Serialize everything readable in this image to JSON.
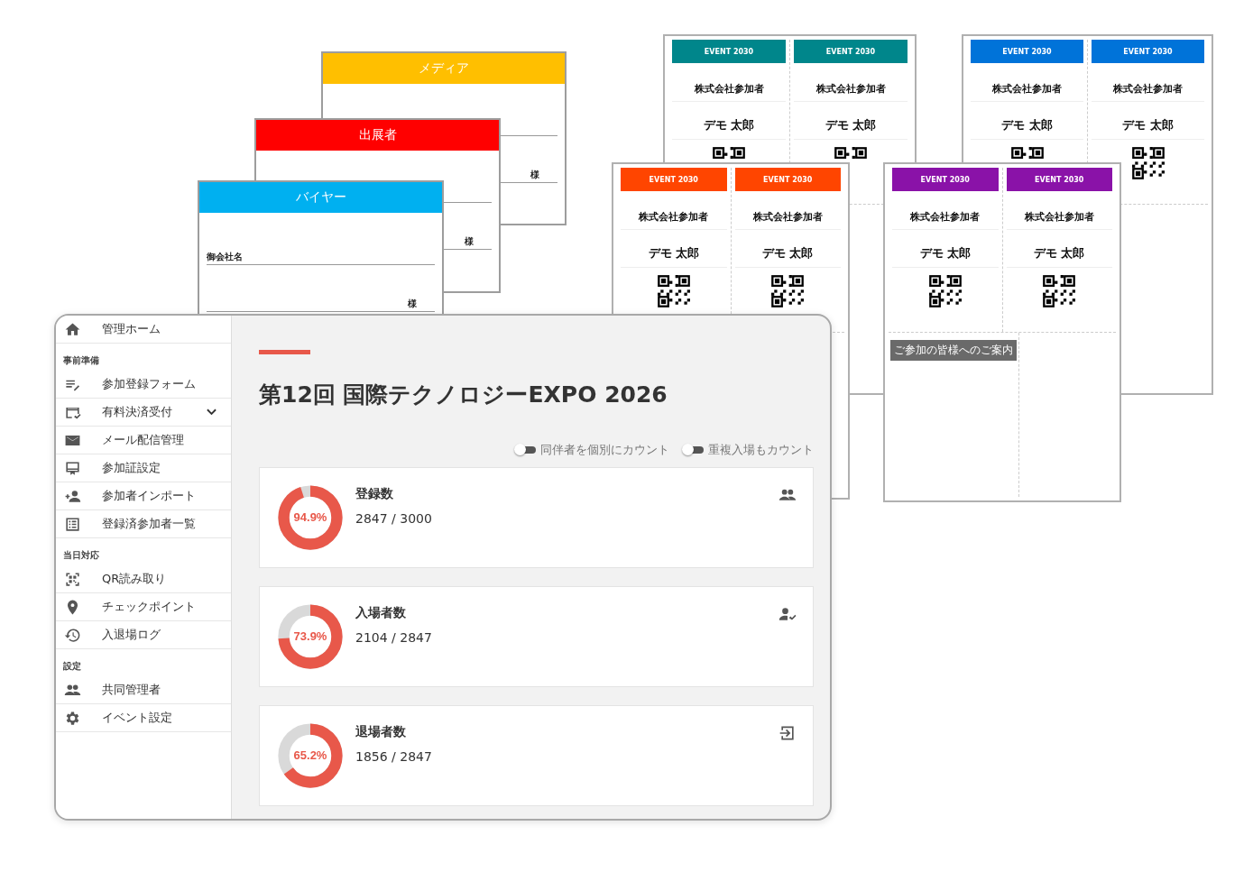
{
  "name_cards": [
    {
      "title": "メディア",
      "color": "#ffbf00",
      "honorific": "様"
    },
    {
      "title": "出展者",
      "color": "#ff0000",
      "honorific": "様"
    },
    {
      "title": "バイヤー",
      "color": "#00b0f0",
      "company_label": "御会社名",
      "honorific": "様"
    }
  ],
  "badge_sheets": [
    {
      "color": "#00868b",
      "badges": [
        {
          "header": "EVENT 2030",
          "company": "株式会社参加者",
          "name": "デモ 太郎"
        },
        {
          "header": "EVENT 2030",
          "company": "株式会社参加者",
          "name": "デモ 太郎"
        }
      ]
    },
    {
      "color": "#0073d9",
      "badges": [
        {
          "header": "EVENT 2030",
          "company": "株式会社参加者",
          "name": "デモ 太郎"
        },
        {
          "header": "EVENT 2030",
          "company": "株式会社参加者",
          "name": "デモ 太郎"
        }
      ]
    },
    {
      "color": "#ff4500",
      "badges": [
        {
          "header": "EVENT 2030",
          "company": "株式会社参加者",
          "name": "デモ 太郎"
        },
        {
          "header": "EVENT 2030",
          "company": "株式会社参加者",
          "name": "デモ 太郎"
        }
      ]
    },
    {
      "color": "#8a12a8",
      "badges": [
        {
          "header": "EVENT 2030",
          "company": "株式会社参加者",
          "name": "デモ 太郎"
        },
        {
          "header": "EVENT 2030",
          "company": "株式会社参加者",
          "name": "デモ 太郎"
        }
      ],
      "notice": "ご参加の皆様へのご案内"
    }
  ],
  "admin": {
    "sidebar": [
      {
        "kind": "link",
        "label": "管理ホーム",
        "submenu": false
      },
      {
        "kind": "header",
        "label": "事前準備"
      },
      {
        "kind": "link",
        "label": "参加登録フォーム",
        "submenu": false
      },
      {
        "kind": "link",
        "label": "有料決済受付",
        "submenu": true
      },
      {
        "kind": "link",
        "label": "メール配信管理",
        "submenu": false
      },
      {
        "kind": "link",
        "label": "参加証設定",
        "submenu": false
      },
      {
        "kind": "link",
        "label": "参加者インポート",
        "submenu": false
      },
      {
        "kind": "link",
        "label": "登録済参加者一覧",
        "submenu": false
      },
      {
        "kind": "header",
        "label": "当日対応"
      },
      {
        "kind": "link",
        "label": "QR読み取り",
        "submenu": false
      },
      {
        "kind": "link",
        "label": "チェックポイント",
        "submenu": false
      },
      {
        "kind": "link",
        "label": "入退場ログ",
        "submenu": false
      },
      {
        "kind": "header",
        "label": "設定"
      },
      {
        "kind": "link",
        "label": "共同管理者",
        "submenu": false
      },
      {
        "kind": "link",
        "label": "イベント設定",
        "submenu": false
      }
    ],
    "title": "第12回 国際テクノロジーEXPO 2026",
    "toggles": [
      {
        "label": "同伴者を個別にカウント",
        "on": false
      },
      {
        "label": "重複入場もカウント",
        "on": false
      }
    ],
    "stats": [
      {
        "label": "登録数",
        "value": "2847 / 3000",
        "percent": "94.9%",
        "level": 0.949
      },
      {
        "label": "入場者数",
        "value": "2104 / 2847",
        "percent": "73.9%",
        "level": 0.739
      },
      {
        "label": "退場者数",
        "value": "1856 / 2847",
        "percent": "65.2%",
        "level": 0.652
      }
    ]
  }
}
